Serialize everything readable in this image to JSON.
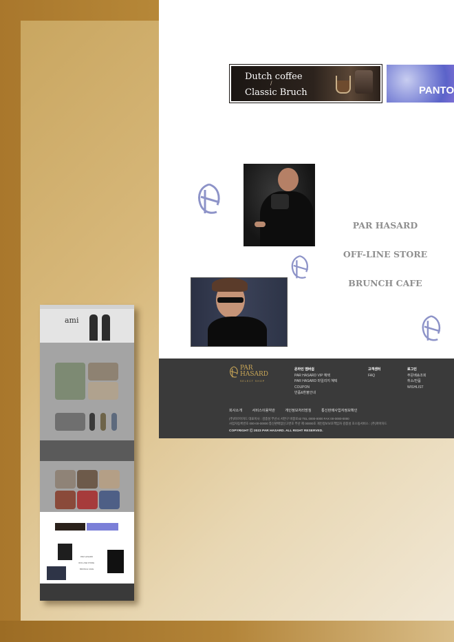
{
  "banners": {
    "coffee_line1": "Dutch coffee",
    "coffee_divider": "/",
    "coffee_line2": "Classic Bruch",
    "pantone_text": "PANTO"
  },
  "menu": {
    "items": [
      {
        "label": "PAR HASARD"
      },
      {
        "label": "OFF-LINE STORE"
      },
      {
        "label": "BRUNCH CAFE"
      }
    ]
  },
  "footer": {
    "logo_name_line1": "PAR",
    "logo_name_line2": "HASARD",
    "logo_sub": "SELECT SHOP",
    "col1": {
      "head": "온라인 멤버쉽",
      "items": [
        "PAR HASARD VIP 혜택",
        "PAR HASARD 마일리지 혜택",
        "COUPON",
        "반품&환불안내"
      ]
    },
    "col2": {
      "head": "고객센터",
      "items": [
        "FAQ"
      ]
    },
    "col3": {
      "head": "로그인",
      "items": [
        "주문배송조회",
        "취소/반품",
        "WISHLIST"
      ]
    },
    "links": [
      "회사소개",
      "서비스이용약관",
      "개인정보처리방침",
      "통신판매사업자정보확인"
    ],
    "info_line1": "(주)파르아자드    대표이사 : 김종성    부산시 서면구 비봉로42    TEL 0000-0000    FAX 00-0000-0000",
    "info_line2": "사업자등록번호 000-00-00000    통신판매업신고번호 부산 제 00000호    개인정보보호책임자 김종성    호스팅서비스 : (주)파아자드",
    "copyright": "COPYRIGHT ⓒ 2023 PAR HASARD. ALL RIGHT RESERVED."
  },
  "mini_preview": {
    "brand": "ami",
    "menu_items": [
      "PAR HASARD",
      "OFF-LINE STORE",
      "BRUNCH CAFE"
    ]
  },
  "colors": {
    "accent_gold": "#c9a657",
    "menu_gray": "#8f8f8f",
    "footer_bg": "#3a3a3a",
    "mark_blue": "#8d93c8"
  }
}
